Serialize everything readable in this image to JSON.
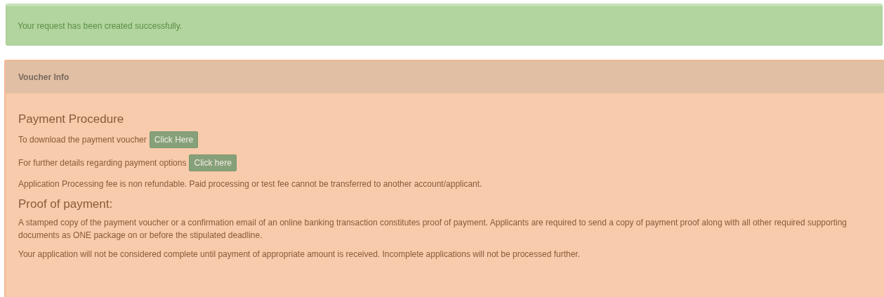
{
  "alert": {
    "message": "Your request has been created successfully."
  },
  "panel": {
    "title": "Voucher Info",
    "items": [
      {
        "kind": "heading",
        "text": "Payment Procedure"
      },
      {
        "kind": "action",
        "text": "To download the payment voucher",
        "button": "Click Here"
      },
      {
        "kind": "action",
        "text": "For further details regarding payment options",
        "button": "Click here"
      },
      {
        "kind": "paragraph",
        "text": "Application Processing fee is non refundable. Paid processing or test fee cannot be transferred to another account/applicant."
      },
      {
        "kind": "heading",
        "text": "Proof of payment:"
      },
      {
        "kind": "paragraph",
        "text": "A stamped copy of the payment voucher or a confirmation email of an online banking transaction constitutes proof of payment. Applicants are required to send a copy of payment proof along with all other required supporting documents as ONE package on or before the stipulated deadline."
      },
      {
        "kind": "paragraph",
        "text": "Your application will not be considered complete until payment of appropriate amount is received. Incomplete applications will not be processed further."
      }
    ]
  }
}
